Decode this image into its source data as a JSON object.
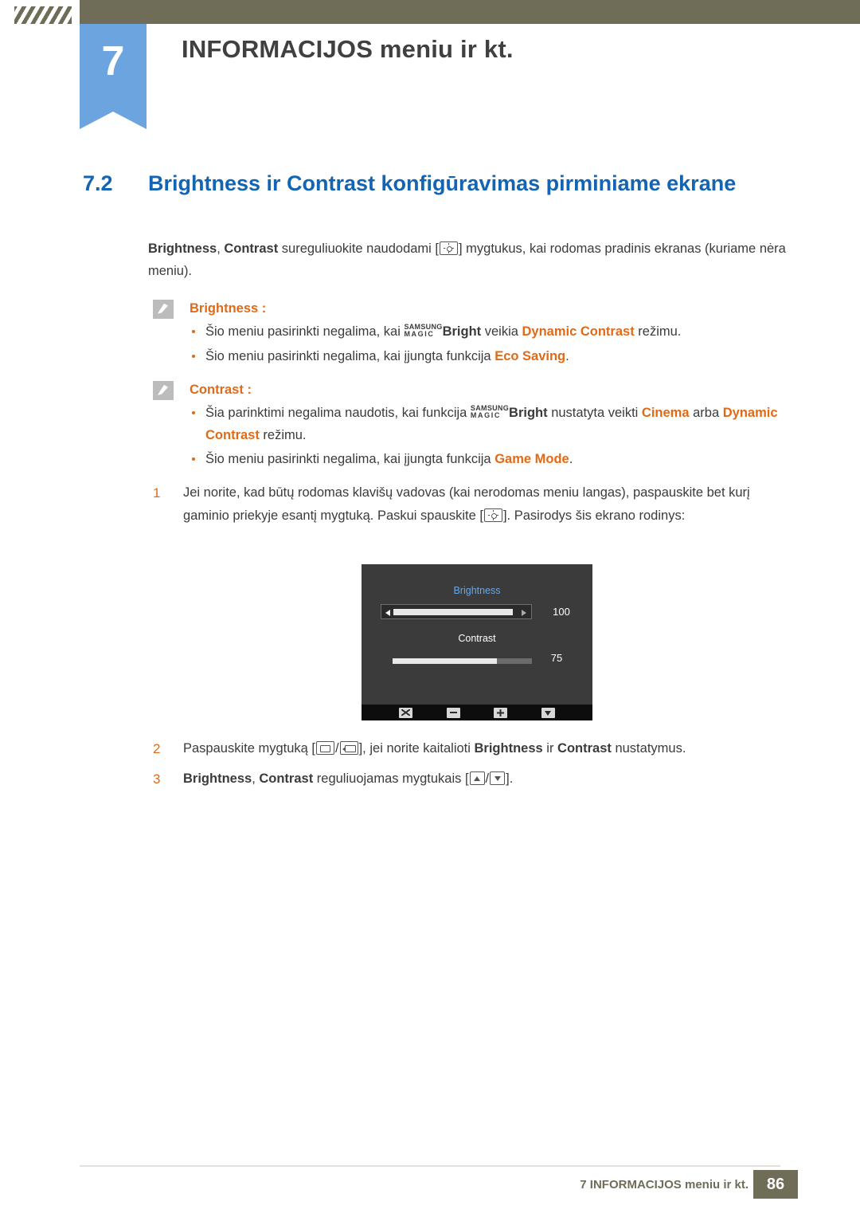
{
  "header": {
    "chapter_number": "7",
    "chapter_title": "INFORMACIJOS meniu ir kt."
  },
  "section": {
    "number": "7.2",
    "title": "Brightness ir Contrast konfigūravimas pirminiame ekrane"
  },
  "intro": {
    "part1": "Brightness",
    "sep1": ", ",
    "part2": "Contrast",
    "part3": " sureguliuokite naudodami [",
    "part4": "] mygtukus, kai rodomas pradinis ekranas (kuriame nėra meniu)."
  },
  "notes": [
    {
      "title": "Brightness",
      "colon": ":",
      "bullets": [
        {
          "pre": "Šio meniu pasirinkti negalima, kai ",
          "magic_top": "SAMSUNG",
          "magic_bottom": "MAGIC",
          "bright": "Bright",
          "mid": " veikia ",
          "hl": "Dynamic Contrast",
          "post": " režimu."
        },
        {
          "pre": "Šio meniu pasirinkti negalima, kai įjungta funkcija ",
          "hl": "Eco Saving",
          "post": "."
        }
      ]
    },
    {
      "title": "Contrast",
      "colon": ":",
      "bullets": [
        {
          "pre": "Šia parinktimi negalima naudotis, kai funkcija ",
          "magic_top": "SAMSUNG",
          "magic_bottom": "MAGIC",
          "bright": "Bright",
          "mid": " nustatyta veikti ",
          "hl": "Cinema",
          "mid2": " arba ",
          "hl2": "Dynamic Contrast",
          "post": " režimu."
        },
        {
          "pre": "Šio meniu pasirinkti negalima, kai įjungta funkcija ",
          "hl": "Game Mode",
          "post": "."
        }
      ]
    }
  ],
  "steps": {
    "one": {
      "num": "1",
      "text_a": "Jei norite, kad būtų rodomas klavišų vadovas (kai nerodomas meniu langas), paspauskite bet kurį gaminio priekyje esantį mygtuką. Paskui spauskite [",
      "text_b": "]. Pasirodys šis ekrano rodinys:"
    },
    "two": {
      "num": "2",
      "text_a": "Paspauskite mygtuką [",
      "slash": "/",
      "text_b": "], jei norite kaitalioti ",
      "hl1": "Brightness",
      "text_c": " ir ",
      "hl2": "Contrast",
      "text_d": " nustatymus."
    },
    "three": {
      "num": "3",
      "hl1": "Brightness",
      "sep": ", ",
      "hl2": "Contrast",
      "text_a": " reguliuojamas mygtukais [",
      "slash": "/",
      "text_b": "]."
    }
  },
  "osd": {
    "brightness_label": "Brightness",
    "brightness_value": "100",
    "contrast_label": "Contrast",
    "contrast_value": "75"
  },
  "footer": {
    "text": "7 INFORMACIJOS meniu ir kt.",
    "page": "86"
  },
  "colors": {
    "accent_blue": "#1464b4",
    "orange": "#e06a16",
    "band": "#6f6c57",
    "badge_blue": "#6ba4de"
  }
}
